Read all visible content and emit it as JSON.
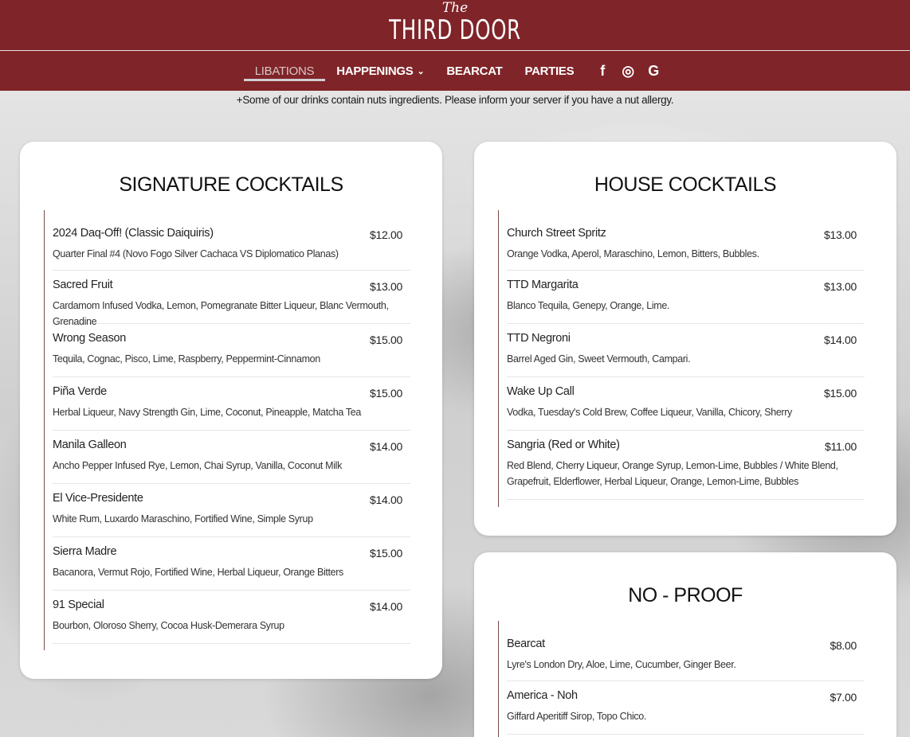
{
  "header": {
    "logo_the": "The",
    "logo_main": "THIRD DOOR",
    "nav": [
      {
        "label": "LIBATIONS",
        "active": true
      },
      {
        "label": "HAPPENINGS",
        "dropdown": true
      },
      {
        "label": "BEARCAT"
      },
      {
        "label": "PARTIES"
      }
    ],
    "social": [
      {
        "icon": "facebook-icon",
        "glyph": "f"
      },
      {
        "icon": "instagram-icon",
        "glyph": "◎"
      },
      {
        "icon": "google-icon",
        "glyph": "G"
      }
    ],
    "chevron_glyph": "⌄"
  },
  "notice": "+Some of our drinks contain nuts ingredients. Please inform your server if you have a nut allergy.",
  "sections": {
    "signature": {
      "title": "SIGNATURE COCKTAILS",
      "items": [
        {
          "name": "2024 Daq-Off! (Classic Daiquiris)",
          "desc": "Quarter Final #4 (Novo Fogo Silver Cachaca VS Diplomatico Planas)",
          "price": "$12.00"
        },
        {
          "name": "Sacred Fruit",
          "desc": "Cardamom Infused Vodka, Lemon, Pomegranate Bitter Liqueur, Blanc Vermouth, Grenadine",
          "price": "$13.00"
        },
        {
          "name": "Wrong Season",
          "desc": "Tequila, Cognac, Pisco, Lime, Raspberry, Peppermint-Cinnamon",
          "price": "$15.00"
        },
        {
          "name": "Piña Verde",
          "desc": "Herbal Liqueur, Navy Strength Gin, Lime, Coconut, Pineapple, Matcha Tea",
          "price": "$15.00"
        },
        {
          "name": "Manila Galleon",
          "desc": "Ancho Pepper Infused Rye, Lemon, Chai Syrup, Vanilla, Coconut Milk",
          "price": "$14.00"
        },
        {
          "name": "El Vice-Presidente",
          "desc": "White Rum, Luxardo Maraschino, Fortified Wine, Simple Syrup",
          "price": "$14.00"
        },
        {
          "name": "Sierra Madre",
          "desc": "Bacanora, Vermut Rojo, Fortified Wine, Herbal Liqueur, Orange Bitters",
          "price": "$15.00"
        },
        {
          "name": "91 Special",
          "desc": "Bourbon, Oloroso Sherry, Cocoa Husk-Demerara Syrup",
          "price": "$14.00"
        }
      ]
    },
    "house": {
      "title": "HOUSE COCKTAILS",
      "items": [
        {
          "name": "Church Street Spritz",
          "desc": "Orange Vodka, Aperol, Maraschino, Lemon, Bitters, Bubbles.",
          "price": "$13.00"
        },
        {
          "name": "TTD Margarita",
          "desc": "Blanco Tequila, Genepy, Orange, Lime.",
          "price": "$13.00"
        },
        {
          "name": "TTD Negroni",
          "desc": "Barrel Aged Gin, Sweet Vermouth, Campari.",
          "price": "$14.00"
        },
        {
          "name": "Wake Up Call",
          "desc": "Vodka, Tuesday's Cold Brew, Coffee Liqueur, Vanilla, Chicory, Sherry",
          "price": "$15.00"
        },
        {
          "name": "Sangria (Red or White)",
          "desc": "Red Blend, Cherry Liqueur, Orange Syrup, Lemon-Lime, Bubbles / White Blend, Grapefruit, Elderflower, Herbal Liqueur, Orange, Lemon-Lime, Bubbles",
          "price": "$11.00"
        }
      ]
    },
    "noproof": {
      "title": "NO - PROOF",
      "items": [
        {
          "name": "Bearcat",
          "desc": "Lyre's London Dry, Aloe, Lime, Cucumber, Ginger Beer.",
          "price": "$8.00"
        },
        {
          "name": "America - Noh",
          "desc": "Giffard Aperitiff Sirop, Topo Chico.",
          "price": "$7.00"
        }
      ]
    }
  },
  "colors": {
    "header_bg": "#7f2428",
    "card_bg": "#ffffff",
    "rule": "#7a4a4a"
  }
}
